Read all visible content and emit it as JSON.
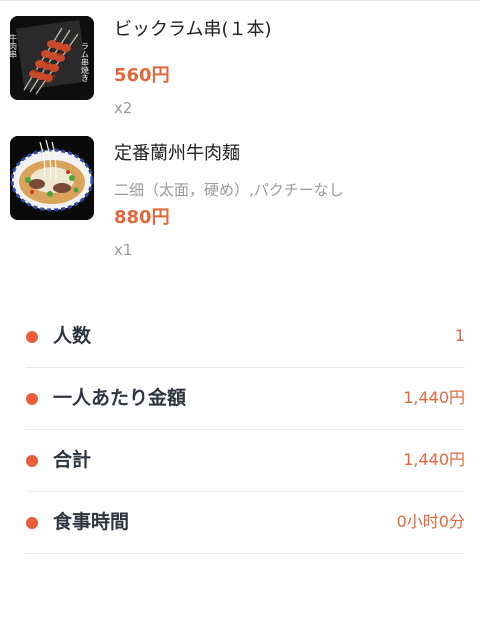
{
  "order": {
    "items": [
      {
        "name": "ビックラム串(１本)",
        "options": "",
        "price": "560円",
        "quantity": "x2",
        "image_icon": "lamb-skewer-photo",
        "image_text": "牛肉串 ラム串焼き"
      },
      {
        "name": "定番蘭州牛肉麺",
        "options": "二细（太面，硬め）,パクチーなし",
        "price": "880円",
        "quantity": "x1",
        "image_icon": "beef-noodle-photo"
      }
    ]
  },
  "summary": {
    "rows": [
      {
        "label": "人数",
        "value": "1"
      },
      {
        "label": "一人あたり金額",
        "value": "1,440円"
      },
      {
        "label": "合計",
        "value": "1,440円"
      },
      {
        "label": "食事時間",
        "value": "0小时0分"
      }
    ]
  },
  "colors": {
    "price": "#e2683c",
    "bullet": "#e95f3c",
    "label": "#2d3640",
    "muted": "#9a9a9a",
    "divider": "#e8e8e8"
  }
}
